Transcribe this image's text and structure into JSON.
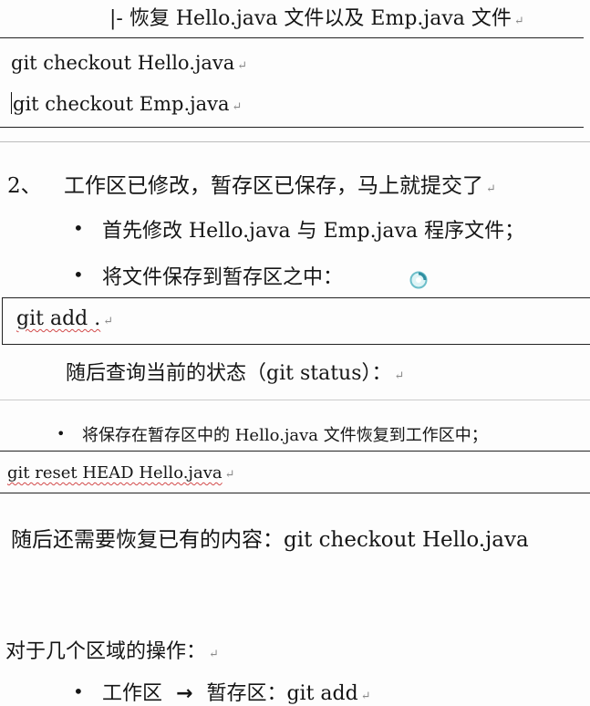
{
  "heading_restore": "|- 恢复 Hello.java 文件以及 Emp.java 文件",
  "code_checkout_hello": "git checkout Hello.java",
  "code_checkout_emp": "git checkout Emp.java",
  "section2_number": "2、",
  "section2_title": "工作区已修改，暂存区已保存，马上就提交了",
  "bullet_modify": "首先修改 Hello.java 与 Emp.java 程序文件；",
  "bullet_save": "将文件保存到暂存区之中：",
  "code_add": "git add .",
  "query_status": "随后查询当前的状态（git status）：",
  "bullet_restore": "将保存在暂存区中的 Hello.java 文件恢复到工作区中；",
  "code_reset": "git reset HEAD Hello.java",
  "restore_content": "随后还需要恢复已有的内容：git checkout Hello.java",
  "ops_heading": "对于几个区域的操作：",
  "bullet_ops_workspace": "工作区",
  "bullet_ops_arrow": "→",
  "bullet_ops_stage": "暂存区：git add",
  "paragraph_mark": "↵"
}
